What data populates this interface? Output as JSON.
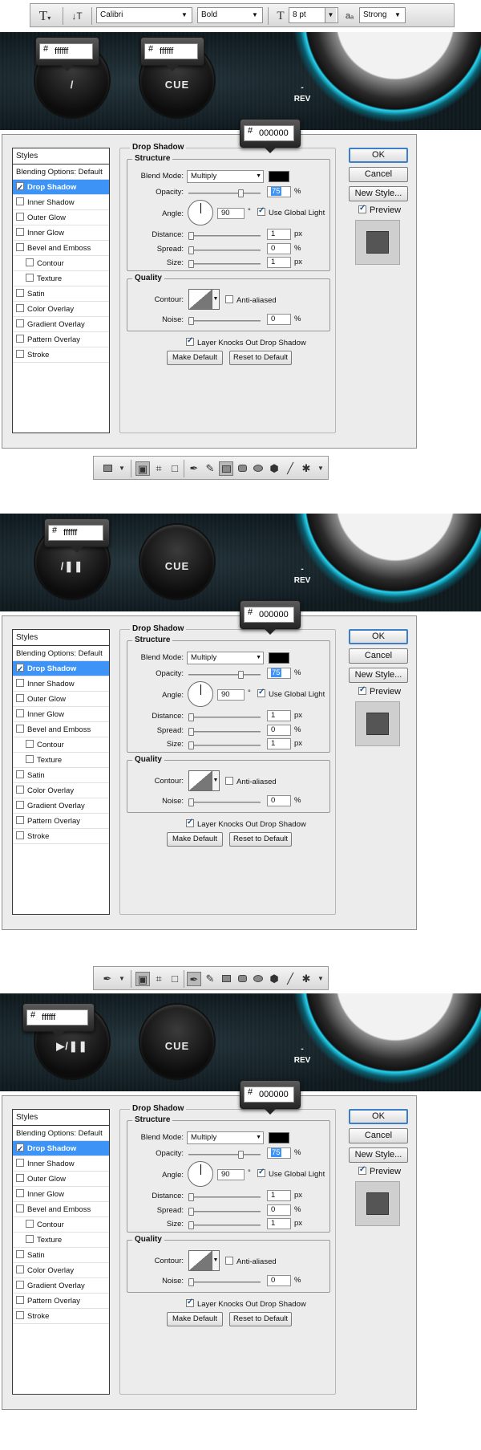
{
  "text_toolbar": {
    "font_family": "Calibri",
    "font_style": "Bold",
    "font_size": "8 pt",
    "aa_label": "aₐ",
    "antialias": "Strong"
  },
  "banners": [
    {
      "tip_hash": "#",
      "tip_value": "ffffff",
      "tip2_hash": "#",
      "tip2_value": "ffffff",
      "knob1": "/",
      "knob2": "CUE",
      "rev": "REV",
      "rev_dash": "-"
    },
    {
      "tip_hash": "#",
      "tip_value": "ffffff",
      "knob1": "/❚❚",
      "knob2": "CUE",
      "rev": "REV",
      "rev_dash": "-"
    },
    {
      "tip_hash": "#",
      "tip_value": "ffffff",
      "knob1": "▶/❚❚",
      "knob2": "CUE",
      "rev": "REV",
      "rev_dash": "-"
    }
  ],
  "dialog": {
    "styles_header": "Styles",
    "items": [
      {
        "label": "Blending Options: Default"
      },
      {
        "label": "Drop Shadow"
      },
      {
        "label": "Inner Shadow"
      },
      {
        "label": "Outer Glow"
      },
      {
        "label": "Inner Glow"
      },
      {
        "label": "Bevel and Emboss"
      },
      {
        "label": "Contour"
      },
      {
        "label": "Texture"
      },
      {
        "label": "Satin"
      },
      {
        "label": "Color Overlay"
      },
      {
        "label": "Gradient Overlay"
      },
      {
        "label": "Pattern Overlay"
      },
      {
        "label": "Stroke"
      }
    ],
    "drop_shadow_title": "Drop Shadow",
    "structure_title": "Structure",
    "blend_mode_label": "Blend Mode:",
    "blend_mode_value": "Multiply",
    "opacity_label": "Opacity:",
    "opacity_value": "75",
    "angle_label": "Angle:",
    "angle_value": "90",
    "degree": "°",
    "use_global_light": "Use Global Light",
    "distance_label": "Distance:",
    "distance_value": "1",
    "spread_label": "Spread:",
    "spread_value": "0",
    "size_label": "Size:",
    "size_value": "1",
    "px": "px",
    "percent": "%",
    "quality_title": "Quality",
    "contour_label": "Contour:",
    "anti_aliased": "Anti-aliased",
    "noise_label": "Noise:",
    "noise_value": "0",
    "layer_knocks": "Layer Knocks Out Drop Shadow",
    "make_default": "Make Default",
    "reset_default": "Reset to Default",
    "ok": "OK",
    "cancel": "Cancel",
    "new_style": "New Style...",
    "preview": "Preview",
    "color_hash": "#",
    "color_value": "000000"
  },
  "colors": {
    "accent": "#3d94f6",
    "glow": "#27d4f2",
    "banner": "#142227"
  }
}
